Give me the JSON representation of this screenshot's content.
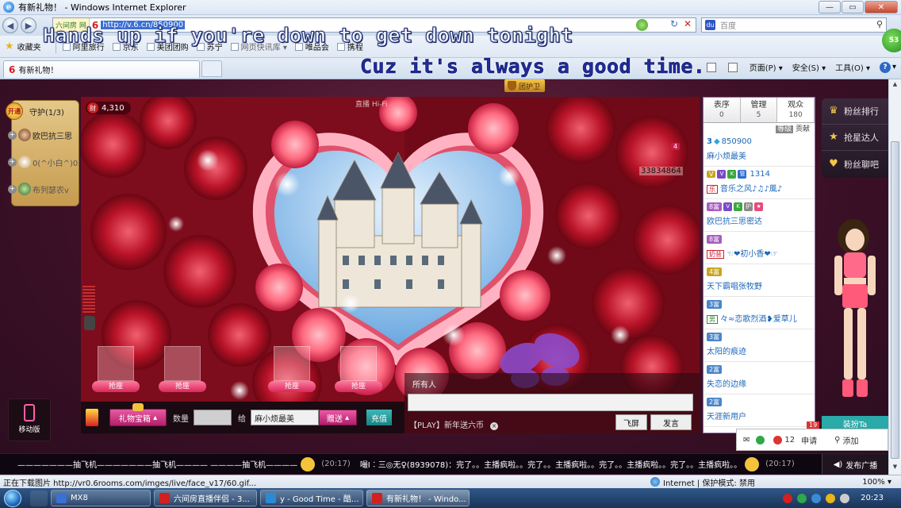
{
  "window": {
    "title": "有新礼物！ - Windows Internet Explorer",
    "buttons": {
      "min": "—",
      "max": "▭",
      "close": "✕"
    }
  },
  "address": {
    "site_tag": "六间房 网",
    "url": "http://v.6.cn/850900",
    "search_placeholder": "百度"
  },
  "favorites": {
    "label": "收藏夹",
    "items": [
      "阿里旅行",
      "京东",
      "美团团购",
      "苏宁",
      "网页快讯库 ▾",
      "唯品会",
      "携程"
    ]
  },
  "tab": {
    "title": "有新礼物！"
  },
  "commands": [
    "页面(P) ▾",
    "安全(S) ▾",
    "工具(O) ▾",
    "▾"
  ],
  "lyrics": {
    "line1": "Hands up if you're down to get down tonight",
    "line2": "Cuz it's always a good time."
  },
  "page": {
    "guard_button": "团护卫",
    "guard_panel": {
      "badge": "开通",
      "title": "守护(1/3)",
      "members": [
        "欧巴抗三思",
        "0(^小白^)0",
        "布列瑟农v"
      ]
    },
    "money": "4,310",
    "money_badge": "财",
    "hifi": "直播  Hi-Fi",
    "room_id": "33834864",
    "count": "4",
    "grab_seats": [
      "抢座",
      "抢座",
      "抢座",
      "抢座"
    ],
    "gift": {
      "box_label": "礼物宝箱",
      "qty_label": "数量",
      "to_label": "给",
      "to_value": "麻小烦最美",
      "send_label": "赠送",
      "recharge_label": "充值"
    },
    "chat": {
      "who": "所有人",
      "hint": "【PLAY】新年送六币",
      "fly_label": "飞屏",
      "speak_label": "发言"
    },
    "userlist": {
      "tabs": [
        {
          "label": "表序",
          "count": "0"
        },
        {
          "label": "管理",
          "count": "5"
        },
        {
          "label": "观众",
          "count": "180"
        }
      ],
      "sort_level": "等级",
      "sort_contrib": "贡献",
      "users": [
        {
          "prefix": "3",
          "id": "850900",
          "name": "麻小烦最美"
        },
        {
          "prefix": "",
          "id": "1314",
          "name": "音乐之风♪♫♪風♪"
        },
        {
          "prefix": "",
          "id": "",
          "name": "欧巴抗三思密达"
        },
        {
          "prefix": "",
          "id": "",
          "name": "☜❤初小香❤☞"
        },
        {
          "prefix": "",
          "id": "",
          "name": "天下霸唱张牧野"
        },
        {
          "prefix": "",
          "id": "",
          "name": "々≈恋歌烈酒❥爱草儿"
        },
        {
          "prefix": "",
          "id": "",
          "name": "太阳的痕迹"
        },
        {
          "prefix": "",
          "id": "",
          "name": "失恋的边缘"
        },
        {
          "prefix": "",
          "id": "",
          "name": "天涯新用户"
        }
      ]
    },
    "side_buttons": [
      "粉丝排行",
      "抢星达人",
      "粉丝聊吧"
    ],
    "dress_label": "装扮Ta",
    "bottom_mini": {
      "badge": "19",
      "count": "12",
      "apply": "申请",
      "add": "添加"
    },
    "mobile_label": "移动版",
    "ticker": {
      "left": "———————抽飞机———————抽飞机———— ————抽飞机————",
      "left_time": "(20:17)",
      "right": "嘬Ι︰三◎无♀(8939078)：完了。。主播疯啦。。完了。。主播疯啦。。完了。。主播疯啦。。完了。。主播疯啦。。",
      "right_time": "(20:17)",
      "broadcast": "发布广播"
    }
  },
  "status": {
    "message": "正在下载图片 http://vr0.6rooms.com/imges/live/face_v17/60.gif...",
    "zone": "Internet | 保护模式: 禁用",
    "zoom": "100% ▾"
  },
  "taskbar": {
    "tasks": [
      "MX8",
      "六间房直播伴侣 - 3...",
      "y - Good Time - 酷...",
      "有新礼物！ - Windo..."
    ],
    "clock": "20:23"
  },
  "colors": {
    "accent_pink": "#d8285a",
    "teal": "#2aa9a9",
    "title_blue": "#1f6cc4"
  }
}
